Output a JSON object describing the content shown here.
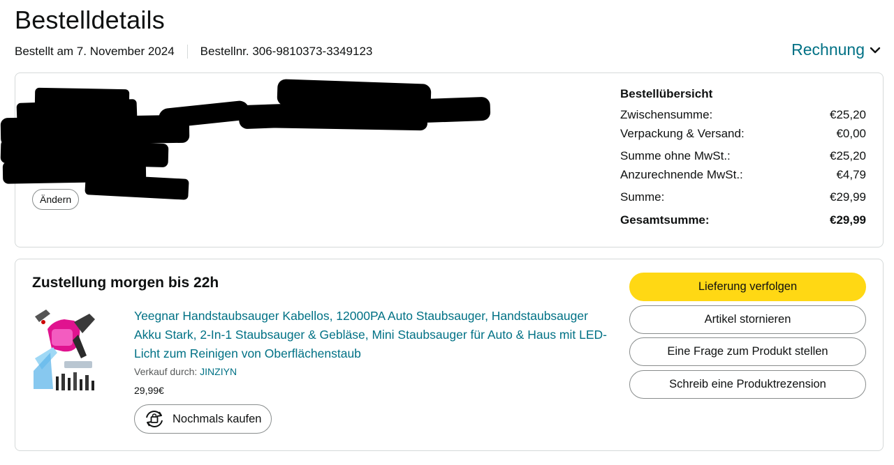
{
  "header": {
    "title": "Bestelldetails",
    "ordered_on": "Bestellt am 7. November 2024",
    "order_number": "Bestellnr. 306-9810373-3349123",
    "invoice_label": "Rechnung",
    "invoice_icon": "chevron-down-icon"
  },
  "address": {
    "change_label": "Ändern"
  },
  "summary": {
    "title": "Bestellübersicht",
    "rows": [
      {
        "label": "Zwischensumme:",
        "value": "€25,20"
      },
      {
        "label": "Verpackung & Versand:",
        "value": "€0,00"
      },
      {
        "label": "Summe ohne MwSt.:",
        "value": "€25,20"
      },
      {
        "label": "Anzurechnende MwSt.:",
        "value": "€4,79"
      },
      {
        "label": "Summe:",
        "value": "€29,99"
      },
      {
        "label": "Gesamtsumme:",
        "value": "€29,99"
      }
    ]
  },
  "shipment": {
    "title": "Zustellung morgen bis 22h",
    "product": {
      "title": "Yeegnar Handstaubsauger Kabellos, 12000PA Auto Staubsauger, Handstaubsauger Akku Stark, 2-In-1 Staubsauger & Gebläse, Mini Staubsauger für Auto & Haus mit LED-Licht zum Reinigen von Oberflächenstaub",
      "seller_prefix": "Verkauf durch:",
      "seller_name": "JINZIYN",
      "price": "29,99€",
      "rebuy_label": "Nochmals kaufen",
      "rebuy_icon": "rebuy-cycle-icon"
    },
    "actions": [
      {
        "label": "Lieferung verfolgen"
      },
      {
        "label": "Artikel stornieren"
      },
      {
        "label": "Eine Frage zum Produkt stellen"
      },
      {
        "label": "Schreib eine Produktrezension"
      }
    ]
  },
  "colors": {
    "link": "#007185",
    "primary_button": "#ffd814",
    "border": "#d5d9d9",
    "product_accent": "#e0138f"
  }
}
